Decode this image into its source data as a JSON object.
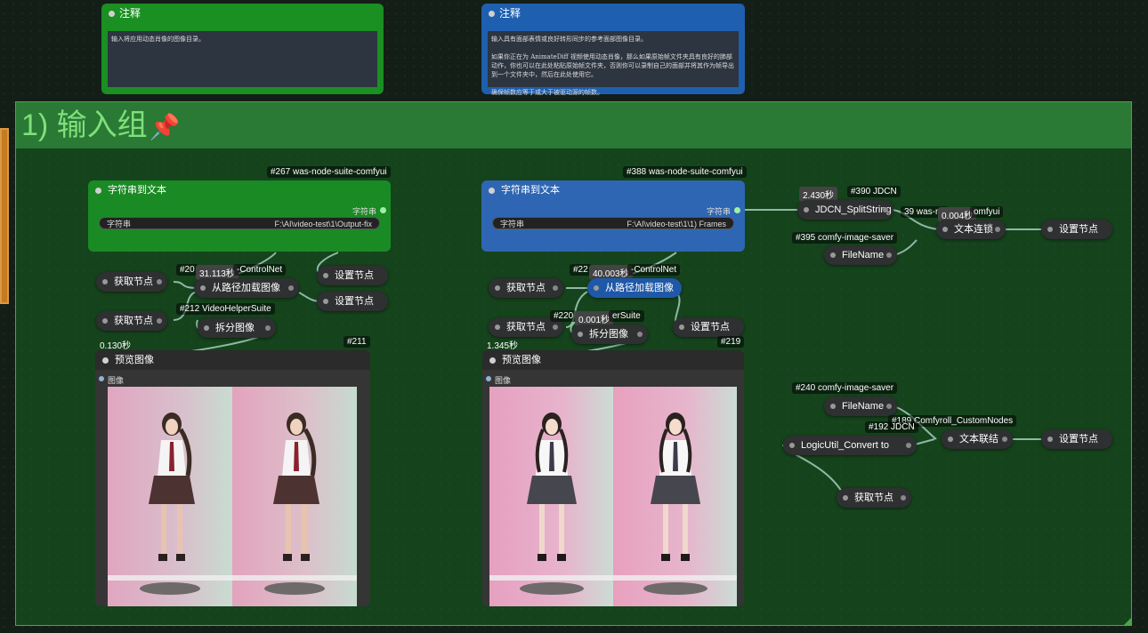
{
  "notes": [
    {
      "title": "注释",
      "color": "#1a8f22",
      "text": "输入将应用动态肖像的图像目录。"
    },
    {
      "title": "注释",
      "color": "#1e5fb0",
      "text": "输入具有面部表情或良好转形同步的参考面部图像目录。\n\n如果你正在为 AnimateDiff 视频使用动态肖像，那么如果原始帧文件夹具有良好的肺部动作，你也可以在此处粘贴原始帧文件夹，否则你可以录制自己的面部并将其作为帧导出到一个文件夹中，然后在此处使用它。\n\n确保帧数应等于或大于被驱动源的帧数。"
    }
  ],
  "group": {
    "title": "1) 输入组",
    "pin": "📌"
  },
  "left": {
    "badge": "#267 was-node-suite-comfyui",
    "node_title": "字符串到文本",
    "output_label": "字符串",
    "field_label": "字符串",
    "field_value": "F:\\AI\\video-test\\1\\Output-fix",
    "get1": "获取节点",
    "get2": "获取节点",
    "load_badge_id": "#20",
    "load_time": "31.113秒",
    "load_badge_suffix": "-ControlNet",
    "load_title": "从路径加载图像",
    "vhs_badge": "#212 VideoHelperSuite",
    "split_title": "拆分图像",
    "set1": "设置节点",
    "set2": "设置节点",
    "time_small": "0.130秒",
    "preview_badge": "#211",
    "preview_title": "预览图像",
    "preview_input": "图像"
  },
  "middle": {
    "badge": "#388 was-node-suite-comfyui",
    "node_title": "字符串到文本",
    "output_label": "字符串",
    "field_label": "字符串",
    "field_value": "F:\\AI\\video-test\\1\\1) Frames",
    "get1": "获取节点",
    "get2": "获取节点",
    "load_badge_id": "#22",
    "load_time": "40.003秒",
    "load_badge_suffix": "-ControlNet",
    "load_title": "从路径加载图像",
    "split_badge_id": "#220",
    "split_time": "0.001秒",
    "split_badge_suffix": "erSuite",
    "split_title": "拆分图像",
    "set1": "设置节点",
    "time_small": "1.345秒",
    "preview_badge": "#219",
    "preview_title": "预览图像",
    "preview_input": "图像"
  },
  "right": {
    "time1": "2.430秒",
    "badge_390": "#390 JDCN",
    "jdcn_title": "JDCN_SplitString",
    "badge_39x": "39 was-nc",
    "time2": "0.004秒",
    "badge_39x_suffix": "omfyui",
    "concat_title": "文本连锁",
    "set1": "设置节点",
    "badge_395": "#395 comfy-image-saver",
    "filename1": "FileName",
    "badge_240": "#240 comfy-image-saver",
    "filename2": "FileName",
    "badge_189": "#189 Comfyroll_CustomNodes",
    "badge_192": "#192 JDCN",
    "logic_title": "LogicUtil_Convert to",
    "join_title": "文本联结",
    "set2": "设置节点",
    "get1": "获取节点"
  },
  "colors": {
    "green_node": "#1a8a24",
    "blue_node": "#2f66b3",
    "group_border": "#48a848",
    "wire": "#8fb9a6"
  }
}
